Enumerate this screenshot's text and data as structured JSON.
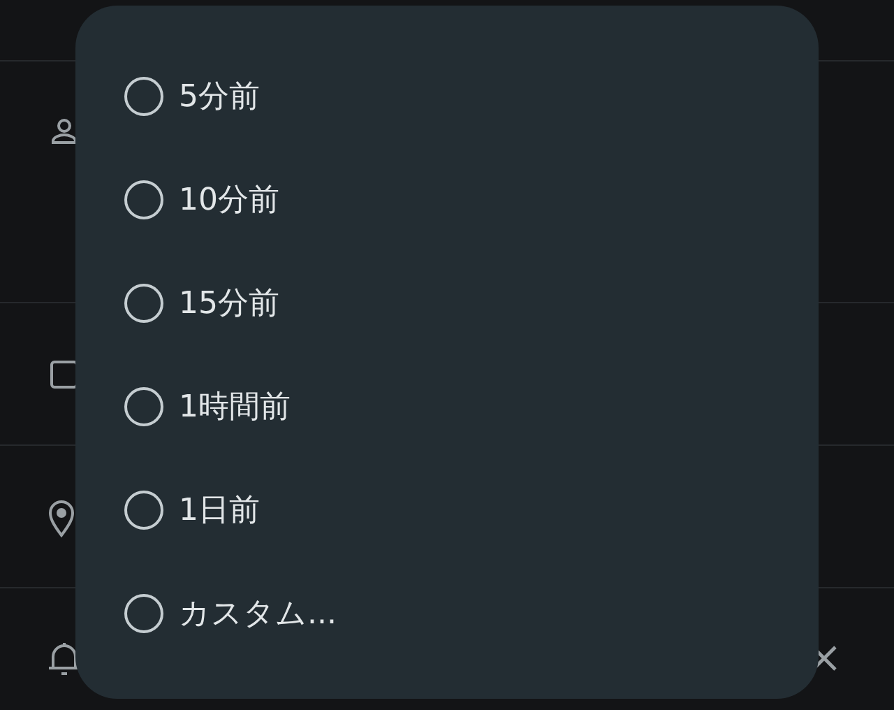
{
  "background_rows": [
    {
      "kind": "person"
    },
    {
      "kind": "square"
    },
    {
      "kind": "pin"
    },
    {
      "kind": "bell",
      "close": true
    }
  ],
  "dialog": {
    "options": [
      {
        "label": "5分前",
        "selected": false
      },
      {
        "label": "10分前",
        "selected": false
      },
      {
        "label": "15分前",
        "selected": false
      },
      {
        "label": "1時間前",
        "selected": false
      },
      {
        "label": "1日前",
        "selected": false
      },
      {
        "label": "カスタム...",
        "selected": false
      }
    ]
  }
}
